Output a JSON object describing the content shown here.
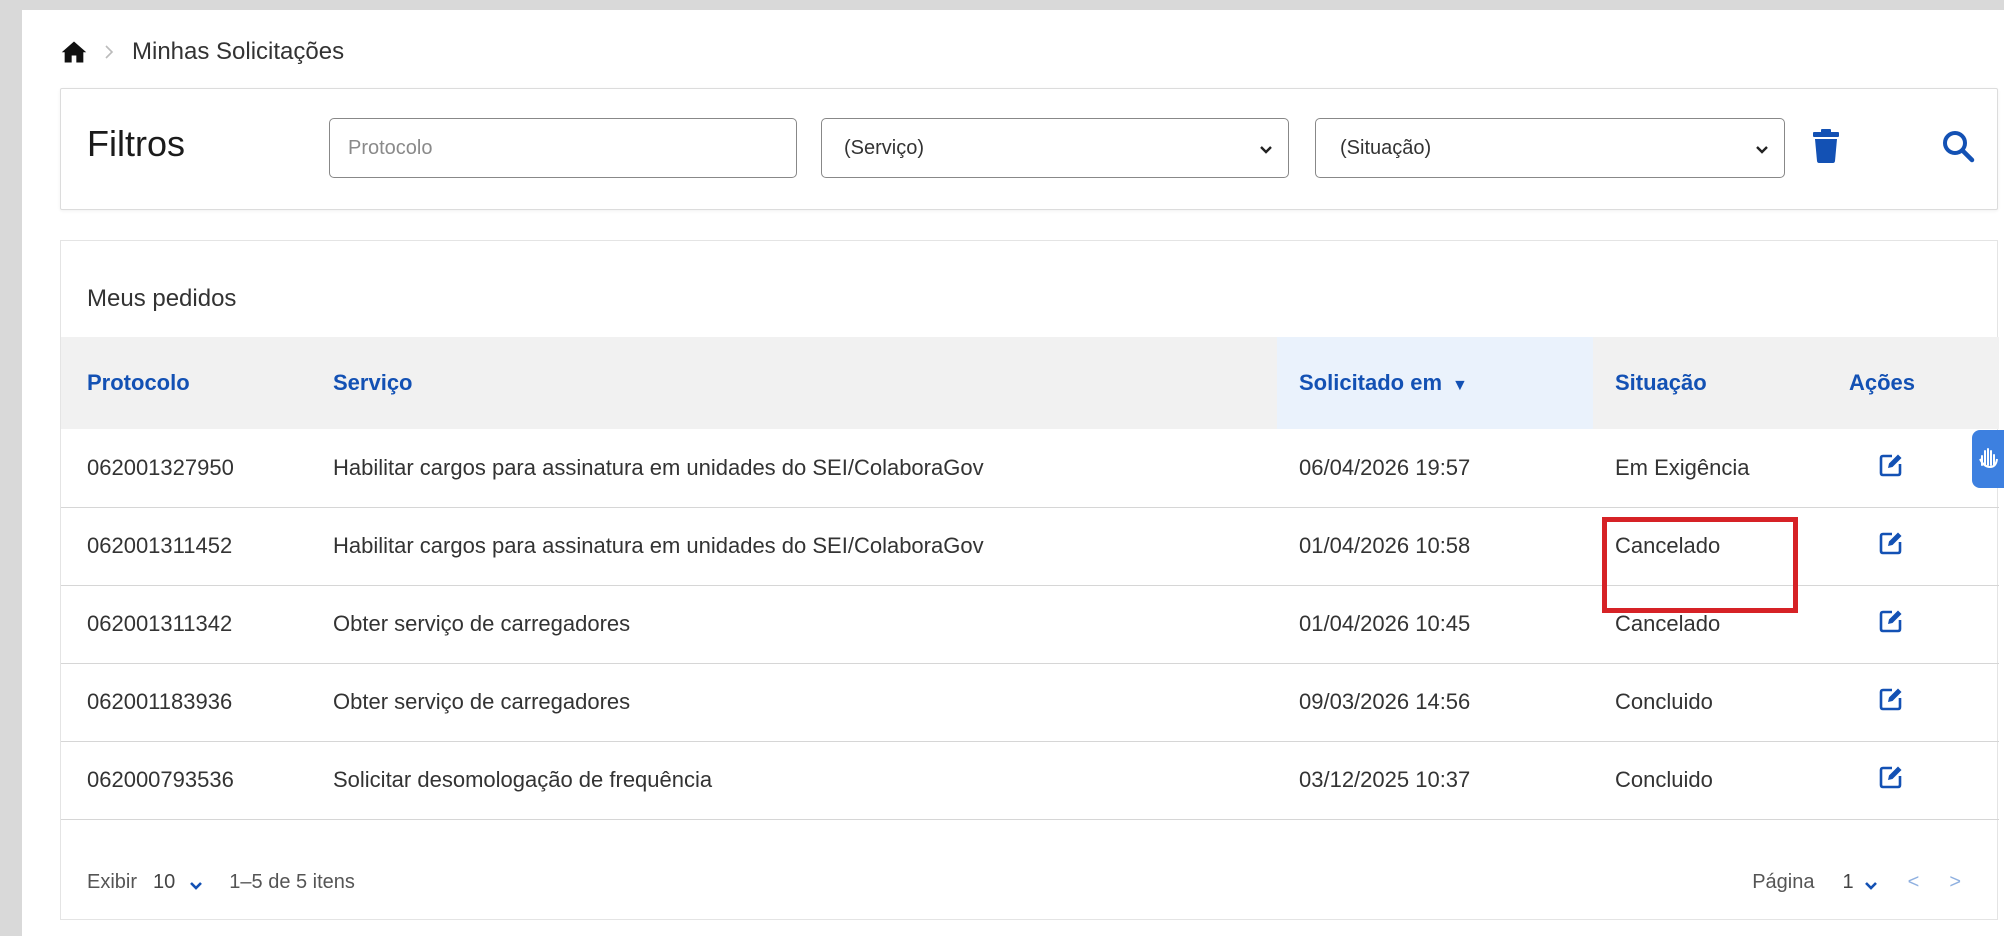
{
  "breadcrumb": {
    "current": "Minhas Solicitações"
  },
  "filters": {
    "title": "Filtros",
    "protocol_placeholder": "Protocolo",
    "service_selected": "(Serviço)",
    "status_selected": "(Situação)"
  },
  "orders": {
    "caption": "Meus pedidos",
    "columns": [
      "Protocolo",
      "Serviço",
      "Solicitado em",
      "Situação",
      "Ações"
    ],
    "sort_indicator": "▼",
    "rows": [
      {
        "protocol": "062001327950",
        "service": "Habilitar cargos para assinatura em unidades do SEI/ColaboraGov",
        "requested": "06/04/2026 19:57",
        "status": "Em Exigência"
      },
      {
        "protocol": "062001311452",
        "service": "Habilitar cargos para assinatura em unidades do SEI/ColaboraGov",
        "requested": "01/04/2026 10:58",
        "status": "Cancelado"
      },
      {
        "protocol": "062001311342",
        "service": "Obter serviço de carregadores",
        "requested": "01/04/2026 10:45",
        "status": "Cancelado"
      },
      {
        "protocol": "062001183936",
        "service": "Obter serviço de carregadores",
        "requested": "09/03/2026 14:56",
        "status": "Concluido"
      },
      {
        "protocol": "062000793536",
        "service": "Solicitar desomologação de frequência",
        "requested": "03/12/2025 10:37",
        "status": "Concluido"
      }
    ]
  },
  "pagination": {
    "show_label": "Exibir",
    "page_size": "10",
    "range": "1–5 de 5 itens",
    "page_label": "Página",
    "page": "1",
    "prev": "<",
    "next": ">"
  },
  "colors": {
    "accent": "#1351b4",
    "highlight": "#d62226"
  },
  "icons": [
    "home-icon",
    "chevron-right-icon",
    "chevron-down-icon",
    "trash-icon",
    "search-icon",
    "edit-icon",
    "accessibility-hands-icon"
  ]
}
